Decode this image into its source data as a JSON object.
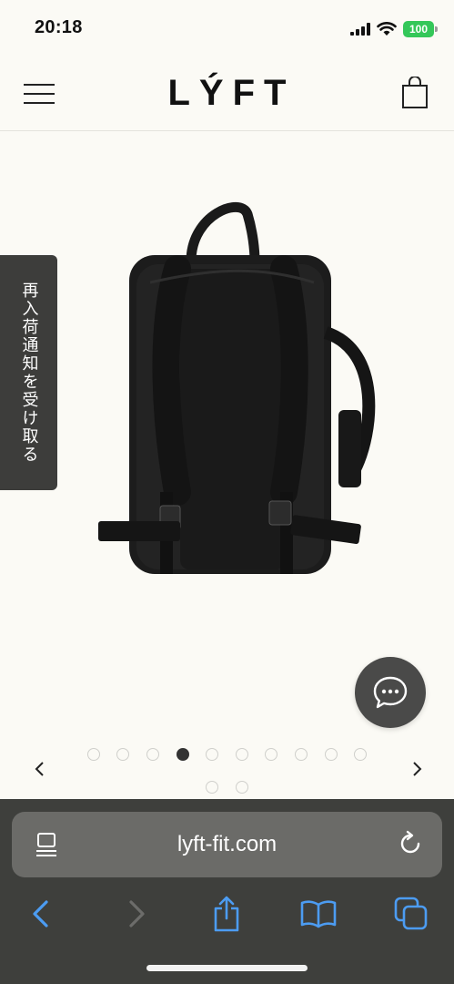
{
  "status_bar": {
    "time": "20:18",
    "battery": "100",
    "icons": [
      "signal-icon",
      "wifi-icon",
      "battery-icon"
    ]
  },
  "header": {
    "logo": "LÝFT",
    "menu_icon": "hamburger-menu-icon",
    "cart_icon": "shopping-bag-icon"
  },
  "product": {
    "image_alt": "black backpack (rear view)"
  },
  "restock_tab": {
    "label": "再入荷通知を受け取る"
  },
  "chat": {
    "icon": "chat-bubble-icon"
  },
  "carousel": {
    "total": 12,
    "active_index": 3,
    "prev_icon": "chevron-left-icon",
    "next_icon": "chevron-right-icon"
  },
  "browser": {
    "url": "lyft-fit.com",
    "icons": [
      "reader-icon",
      "reload-icon",
      "back-icon",
      "forward-icon",
      "share-icon",
      "bookmarks-icon",
      "tabs-icon"
    ]
  },
  "colors": {
    "accent": "#4c9cf2",
    "background": "#fbfaf5",
    "battery": "#34c759",
    "browser_chrome": "#3e3f3c"
  }
}
